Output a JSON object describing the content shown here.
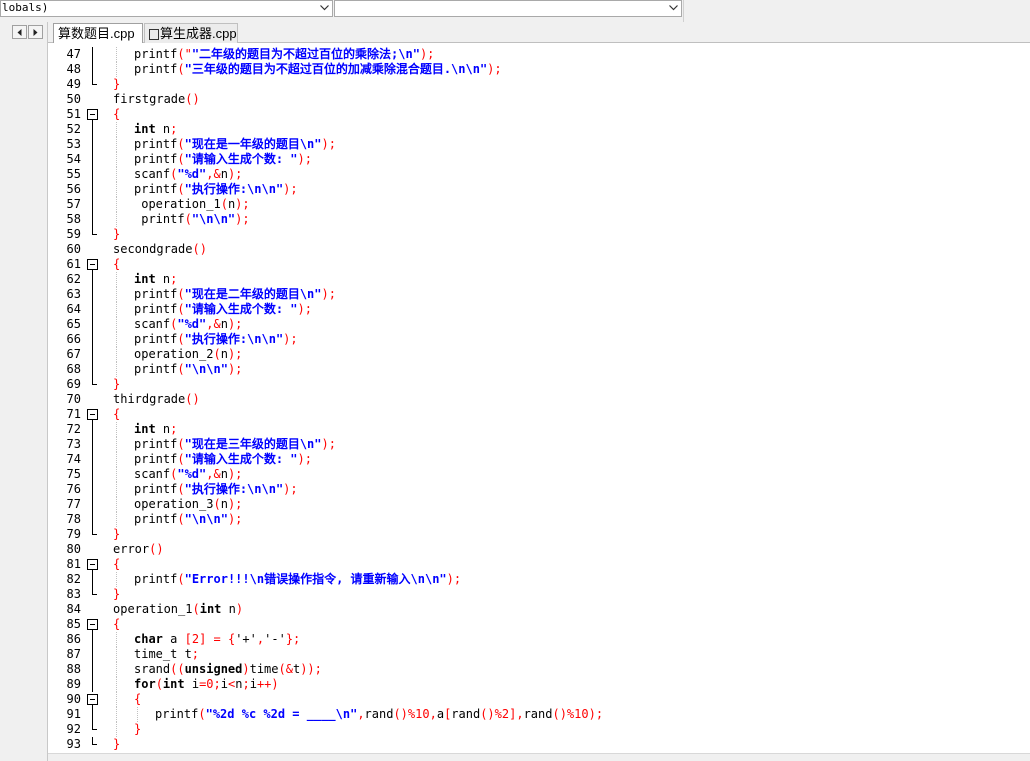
{
  "toolbar": {
    "scope_combo_value": "lobals)",
    "member_combo_value": ""
  },
  "tabs": [
    {
      "label": "算数题目.cpp",
      "active": true
    },
    {
      "label": "算生成器.cpp",
      "active": false,
      "checkbox": true
    }
  ],
  "colors": {
    "string": "#0000ff",
    "punct": "#ff0000",
    "keyword": "#000000",
    "number": "#ff0000"
  },
  "code_lines": [
    {
      "n": "47",
      "i": 1,
      "t": [
        [
          "printf",
          "_"
        ],
        [
          "(\"",
          "p"
        ],
        [
          "\"二年级的题目为不超过百位的乘除法;\\n\"",
          "s"
        ],
        [
          ");",
          "p"
        ]
      ]
    },
    {
      "n": "48",
      "i": 1,
      "t": [
        [
          "printf",
          "_"
        ],
        [
          "(",
          "p"
        ],
        [
          "\"三年级的题目为不超过百位的加减乘除混合题目.\\n\\n\"",
          "s"
        ],
        [
          ");",
          "p"
        ]
      ]
    },
    {
      "n": "49",
      "i": 0,
      "t": [
        [
          "}",
          "p"
        ]
      ]
    },
    {
      "n": "50",
      "i": 0,
      "t": [
        [
          "firstgrade",
          "_"
        ],
        [
          "()",
          "p"
        ]
      ]
    },
    {
      "n": "51",
      "i": 0,
      "t": [
        [
          "{",
          "p"
        ]
      ]
    },
    {
      "n": "52",
      "i": 1,
      "t": [
        [
          "int",
          "k"
        ],
        [
          " n",
          "_"
        ],
        [
          ";",
          "p"
        ]
      ]
    },
    {
      "n": "53",
      "i": 1,
      "t": [
        [
          "printf",
          "_"
        ],
        [
          "(",
          "p"
        ],
        [
          "\"现在是一年级的题目\\n\"",
          "s"
        ],
        [
          ");",
          "p"
        ]
      ]
    },
    {
      "n": "54",
      "i": 1,
      "t": [
        [
          "printf",
          "_"
        ],
        [
          "(",
          "p"
        ],
        [
          "\"请输入生成个数: \"",
          "s"
        ],
        [
          ");",
          "p"
        ]
      ]
    },
    {
      "n": "55",
      "i": 1,
      "t": [
        [
          "scanf",
          "_"
        ],
        [
          "(",
          "p"
        ],
        [
          "\"%d\"",
          "s"
        ],
        [
          ",&",
          "p"
        ],
        [
          "n",
          "_"
        ],
        [
          ");",
          "p"
        ]
      ]
    },
    {
      "n": "56",
      "i": 1,
      "t": [
        [
          "printf",
          "_"
        ],
        [
          "(",
          "p"
        ],
        [
          "\"执行操作:\\n\\n\"",
          "s"
        ],
        [
          ");",
          "p"
        ]
      ]
    },
    {
      "n": "57",
      "i": 1,
      "t": [
        [
          " operation_1",
          "_"
        ],
        [
          "(",
          "p"
        ],
        [
          "n",
          "_"
        ],
        [
          ");",
          "p"
        ]
      ]
    },
    {
      "n": "58",
      "i": 1,
      "t": [
        [
          " printf",
          "_"
        ],
        [
          "(",
          "p"
        ],
        [
          "\"\\n\\n\"",
          "s"
        ],
        [
          ");",
          "p"
        ]
      ]
    },
    {
      "n": "59",
      "i": 0,
      "t": [
        [
          "}",
          "p"
        ]
      ]
    },
    {
      "n": "60",
      "i": 0,
      "t": [
        [
          "secondgrade",
          "_"
        ],
        [
          "()",
          "p"
        ]
      ]
    },
    {
      "n": "61",
      "i": 0,
      "t": [
        [
          "{",
          "p"
        ]
      ]
    },
    {
      "n": "62",
      "i": 1,
      "t": [
        [
          "int",
          "k"
        ],
        [
          " n",
          "_"
        ],
        [
          ";",
          "p"
        ]
      ]
    },
    {
      "n": "63",
      "i": 1,
      "t": [
        [
          "printf",
          "_"
        ],
        [
          "(",
          "p"
        ],
        [
          "\"现在是二年级的题目\\n\"",
          "s"
        ],
        [
          ");",
          "p"
        ]
      ]
    },
    {
      "n": "64",
      "i": 1,
      "t": [
        [
          "printf",
          "_"
        ],
        [
          "(",
          "p"
        ],
        [
          "\"请输入生成个数: \"",
          "s"
        ],
        [
          ");",
          "p"
        ]
      ]
    },
    {
      "n": "65",
      "i": 1,
      "t": [
        [
          "scanf",
          "_"
        ],
        [
          "(",
          "p"
        ],
        [
          "\"%d\"",
          "s"
        ],
        [
          ",&",
          "p"
        ],
        [
          "n",
          "_"
        ],
        [
          ");",
          "p"
        ]
      ]
    },
    {
      "n": "66",
      "i": 1,
      "t": [
        [
          "printf",
          "_"
        ],
        [
          "(",
          "p"
        ],
        [
          "\"执行操作:\\n\\n\"",
          "s"
        ],
        [
          ");",
          "p"
        ]
      ]
    },
    {
      "n": "67",
      "i": 1,
      "t": [
        [
          "operation_2",
          "_"
        ],
        [
          "(",
          "p"
        ],
        [
          "n",
          "_"
        ],
        [
          ");",
          "p"
        ]
      ]
    },
    {
      "n": "68",
      "i": 1,
      "t": [
        [
          "printf",
          "_"
        ],
        [
          "(",
          "p"
        ],
        [
          "\"\\n\\n\"",
          "s"
        ],
        [
          ");",
          "p"
        ]
      ]
    },
    {
      "n": "69",
      "i": 0,
      "t": [
        [
          "}",
          "p"
        ]
      ]
    },
    {
      "n": "70",
      "i": 0,
      "t": [
        [
          "thirdgrade",
          "_"
        ],
        [
          "()",
          "p"
        ]
      ]
    },
    {
      "n": "71",
      "i": 0,
      "t": [
        [
          "{",
          "p"
        ]
      ]
    },
    {
      "n": "72",
      "i": 1,
      "t": [
        [
          "int",
          "k"
        ],
        [
          " n",
          "_"
        ],
        [
          ";",
          "p"
        ]
      ]
    },
    {
      "n": "73",
      "i": 1,
      "t": [
        [
          "printf",
          "_"
        ],
        [
          "(",
          "p"
        ],
        [
          "\"现在是三年级的题目\\n\"",
          "s"
        ],
        [
          ");",
          "p"
        ]
      ]
    },
    {
      "n": "74",
      "i": 1,
      "t": [
        [
          "printf",
          "_"
        ],
        [
          "(",
          "p"
        ],
        [
          "\"请输入生成个数: \"",
          "s"
        ],
        [
          ");",
          "p"
        ]
      ]
    },
    {
      "n": "75",
      "i": 1,
      "t": [
        [
          "scanf",
          "_"
        ],
        [
          "(",
          "p"
        ],
        [
          "\"%d\"",
          "s"
        ],
        [
          ",&",
          "p"
        ],
        [
          "n",
          "_"
        ],
        [
          ");",
          "p"
        ]
      ]
    },
    {
      "n": "76",
      "i": 1,
      "t": [
        [
          "printf",
          "_"
        ],
        [
          "(",
          "p"
        ],
        [
          "\"执行操作:\\n\\n\"",
          "s"
        ],
        [
          ");",
          "p"
        ]
      ]
    },
    {
      "n": "77",
      "i": 1,
      "t": [
        [
          "operation_3",
          "_"
        ],
        [
          "(",
          "p"
        ],
        [
          "n",
          "_"
        ],
        [
          ");",
          "p"
        ]
      ]
    },
    {
      "n": "78",
      "i": 1,
      "t": [
        [
          "printf",
          "_"
        ],
        [
          "(",
          "p"
        ],
        [
          "\"\\n\\n\"",
          "s"
        ],
        [
          ");",
          "p"
        ]
      ]
    },
    {
      "n": "79",
      "i": 0,
      "t": [
        [
          "}",
          "p"
        ]
      ]
    },
    {
      "n": "80",
      "i": 0,
      "t": [
        [
          "error",
          "_"
        ],
        [
          "()",
          "p"
        ]
      ]
    },
    {
      "n": "81",
      "i": 0,
      "t": [
        [
          "{",
          "p"
        ]
      ]
    },
    {
      "n": "82",
      "i": 1,
      "t": [
        [
          "printf",
          "_"
        ],
        [
          "(",
          "p"
        ],
        [
          "\"Error!!!\\n错误操作指令, 请重新输入\\n\\n\"",
          "s"
        ],
        [
          ");",
          "p"
        ]
      ]
    },
    {
      "n": "83",
      "i": 0,
      "t": [
        [
          "}",
          "p"
        ]
      ]
    },
    {
      "n": "84",
      "i": 0,
      "t": [
        [
          "operation_1",
          "_"
        ],
        [
          "(",
          "p"
        ],
        [
          "int",
          "k"
        ],
        [
          " n",
          "_"
        ],
        [
          ")",
          "p"
        ]
      ]
    },
    {
      "n": "85",
      "i": 0,
      "t": [
        [
          "{",
          "p"
        ]
      ]
    },
    {
      "n": "86",
      "i": 1,
      "t": [
        [
          "char",
          "k"
        ],
        [
          " a ",
          "_"
        ],
        [
          "[",
          "p"
        ],
        [
          "2",
          "n"
        ],
        [
          "]",
          "p"
        ],
        [
          " = {",
          "p"
        ],
        [
          "'+'",
          "_"
        ],
        [
          ",",
          "p"
        ],
        [
          "'-'",
          "_"
        ],
        [
          "};",
          "p"
        ]
      ]
    },
    {
      "n": "87",
      "i": 1,
      "t": [
        [
          "time_t t",
          "_"
        ],
        [
          ";",
          "p"
        ]
      ]
    },
    {
      "n": "88",
      "i": 1,
      "t": [
        [
          "srand",
          "_"
        ],
        [
          "((",
          "p"
        ],
        [
          "unsigned",
          "k"
        ],
        [
          ")",
          "p"
        ],
        [
          "time",
          "_"
        ],
        [
          "(&",
          "p"
        ],
        [
          "t",
          "_"
        ],
        [
          "));",
          "p"
        ]
      ]
    },
    {
      "n": "89",
      "i": 1,
      "t": [
        [
          "for",
          "k"
        ],
        [
          "(",
          "p"
        ],
        [
          "int",
          "k"
        ],
        [
          " i",
          "_"
        ],
        [
          "=",
          "p"
        ],
        [
          "0",
          "n"
        ],
        [
          ";",
          "p"
        ],
        [
          "i",
          "_"
        ],
        [
          "<",
          "p"
        ],
        [
          "n",
          "_"
        ],
        [
          ";",
          "p"
        ],
        [
          "i",
          "_"
        ],
        [
          "++)",
          "p"
        ]
      ]
    },
    {
      "n": "90",
      "i": 1,
      "t": [
        [
          "{",
          "p"
        ]
      ]
    },
    {
      "n": "91",
      "i": 2,
      "t": [
        [
          "printf",
          "_"
        ],
        [
          "(",
          "p"
        ],
        [
          "\"%2d %c %2d = ____\\n\"",
          "s"
        ],
        [
          ",",
          "p"
        ],
        [
          "rand",
          "_"
        ],
        [
          "()%",
          "p"
        ],
        [
          "10",
          "n"
        ],
        [
          ",",
          "p"
        ],
        [
          "a",
          "_"
        ],
        [
          "[",
          "p"
        ],
        [
          "rand",
          "_"
        ],
        [
          "()%",
          "p"
        ],
        [
          "2",
          "n"
        ],
        [
          "],",
          "p"
        ],
        [
          "rand",
          "_"
        ],
        [
          "()%",
          "p"
        ],
        [
          "10",
          "n"
        ],
        [
          ");",
          "p"
        ]
      ]
    },
    {
      "n": "92",
      "i": 1,
      "t": [
        [
          "}",
          "p"
        ]
      ]
    },
    {
      "n": "93",
      "i": 0,
      "t": [
        [
          "}",
          "p"
        ]
      ]
    }
  ]
}
